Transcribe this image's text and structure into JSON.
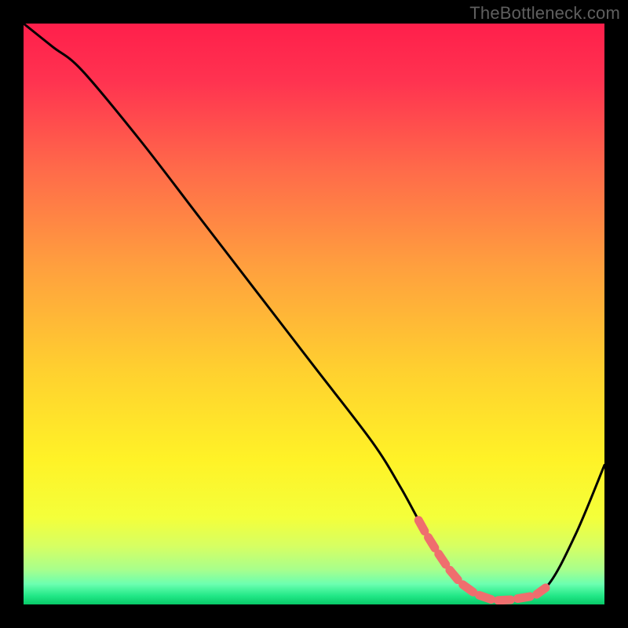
{
  "watermark": "TheBottleneck.com",
  "chart_data": {
    "type": "line",
    "title": "",
    "xlabel": "",
    "ylabel": "",
    "xlim": [
      0,
      100
    ],
    "ylim": [
      0,
      100
    ],
    "series": [
      {
        "name": "curve",
        "x": [
          0,
          5,
          10,
          20,
          30,
          40,
          50,
          60,
          65,
          70,
          75,
          80,
          85,
          90,
          95,
          100
        ],
        "y": [
          100,
          96,
          92,
          80,
          67,
          54,
          41,
          28,
          20,
          11,
          4,
          1,
          1,
          3,
          12,
          24
        ]
      }
    ],
    "highlight_region": {
      "x_start": 68,
      "x_end": 90
    },
    "gradient_stops": [
      {
        "offset": 0.0,
        "color": "#ff1f4b"
      },
      {
        "offset": 0.1,
        "color": "#ff3350"
      },
      {
        "offset": 0.25,
        "color": "#ff6a4a"
      },
      {
        "offset": 0.42,
        "color": "#ffa03e"
      },
      {
        "offset": 0.6,
        "color": "#ffd12f"
      },
      {
        "offset": 0.75,
        "color": "#fff227"
      },
      {
        "offset": 0.85,
        "color": "#f4ff3a"
      },
      {
        "offset": 0.9,
        "color": "#d6ff63"
      },
      {
        "offset": 0.94,
        "color": "#a8ff8c"
      },
      {
        "offset": 0.965,
        "color": "#6bffb0"
      },
      {
        "offset": 0.985,
        "color": "#22e887"
      },
      {
        "offset": 1.0,
        "color": "#08c968"
      }
    ]
  }
}
